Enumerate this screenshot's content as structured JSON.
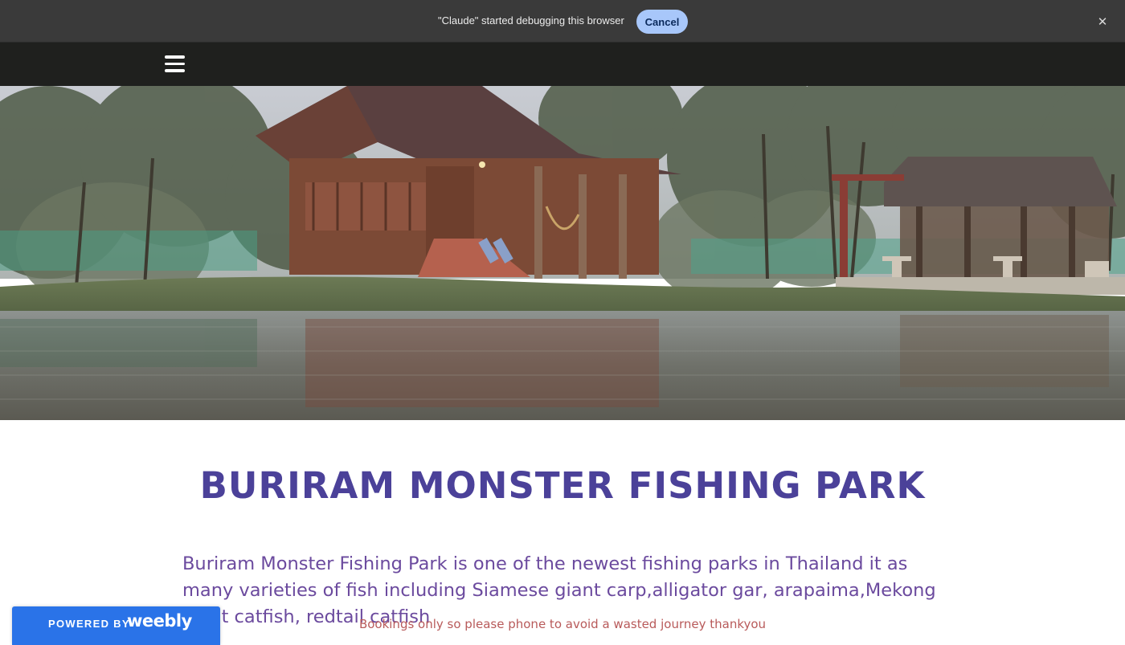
{
  "debug_bar": {
    "message": "\"Claude\" started debugging this browser",
    "cancel_label": "Cancel",
    "close_icon": "close-icon"
  },
  "nav": {
    "menu_icon": "hamburger-menu-icon"
  },
  "hero": {
    "image": "photo of wooden lodges beside a lake with misty trees"
  },
  "content": {
    "title": "BURIRAM MONSTER FISHING PARK",
    "description": "Buriram Monster Fishing Park is one of the newest fishing parks in Thailand it as many varieties of fish including Siamese giant carp,alligator gar, arapaima,Mekong giant catfish, redtail catfish",
    "booking_note": "Bookings  only so please phone to avoid a wasted journey thankyou"
  },
  "badge": {
    "powered_by": "POWERED BY",
    "brand": "weebly"
  },
  "colors": {
    "title": "#4b4199",
    "description": "#6b4a9e",
    "booking": "#b85a5a",
    "weebly_blue": "#2a73e8",
    "nav_bg": "#1f201e",
    "debug_bg": "#3a3a3a",
    "cancel_bg": "#a8c7fa"
  }
}
